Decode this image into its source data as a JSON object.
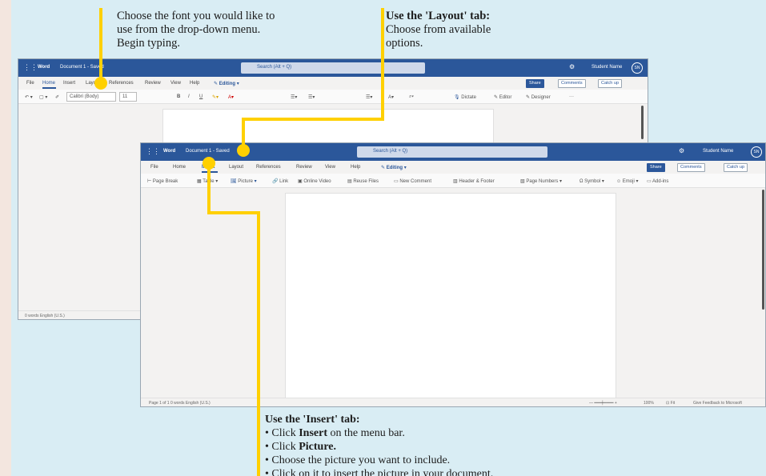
{
  "callouts": {
    "font": {
      "lines": [
        "Choose the font you would like to",
        "use from the drop-down menu.",
        "Begin typing."
      ]
    },
    "layout": {
      "heading": "Use the 'Layout' tab:",
      "lines": [
        "Choose from available",
        "options."
      ]
    },
    "insert": {
      "heading": "Use the 'Insert' tab:",
      "bullets": [
        {
          "pre": "• Click ",
          "bold": "Insert",
          "post": " on the menu bar."
        },
        {
          "pre": "• Click ",
          "bold": "Picture.",
          "post": ""
        },
        {
          "pre": "• Choose the picture you want to include.",
          "bold": "",
          "post": ""
        },
        {
          "pre": "• Click on it to insert the picture in your document.",
          "bold": "",
          "post": ""
        }
      ]
    }
  },
  "back_window": {
    "app": "Word",
    "doc": "Document 1 - Saved",
    "search": "Search (Alt + Q)",
    "user": "Student Name",
    "initials": "SN",
    "menu": [
      "File",
      "Home",
      "Insert",
      "Layout",
      "References",
      "Review",
      "View",
      "Help"
    ],
    "editing": "Editing",
    "share": "Share",
    "comments": "Comments",
    "catchup": "Catch up",
    "font_name": "Calibri (Body)",
    "font_size": "11",
    "dictate": "Dictate",
    "editor": "Editor",
    "designer": "Designer",
    "status": "0 words   English (U.S.)"
  },
  "front_window": {
    "app": "Word",
    "doc": "Document 1 - Saved",
    "search": "Search (Alt + Q)",
    "user": "Student Name",
    "initials": "SN",
    "menu": [
      "File",
      "Home",
      "Insert",
      "Layout",
      "References",
      "Review",
      "View",
      "Help"
    ],
    "editing": "Editing",
    "share": "Share",
    "comments": "Comments",
    "catchup": "Catch up",
    "ribbon": [
      "Page Break",
      "Table",
      "Picture",
      "Link",
      "Online Video",
      "Reuse Files",
      "New Comment",
      "Header & Footer",
      "Page Numbers",
      "Symbol",
      "Emoji",
      "Add-ins"
    ],
    "status_left": "Page 1 of 1   0 words   English (U.S.)",
    "zoom": "100%",
    "fit": "Fit",
    "feedback": "Give Feedback to Microsoft"
  },
  "colors": {
    "accent": "#ffd000",
    "word_blue": "#2b579a",
    "panel": "#d9edf4"
  }
}
